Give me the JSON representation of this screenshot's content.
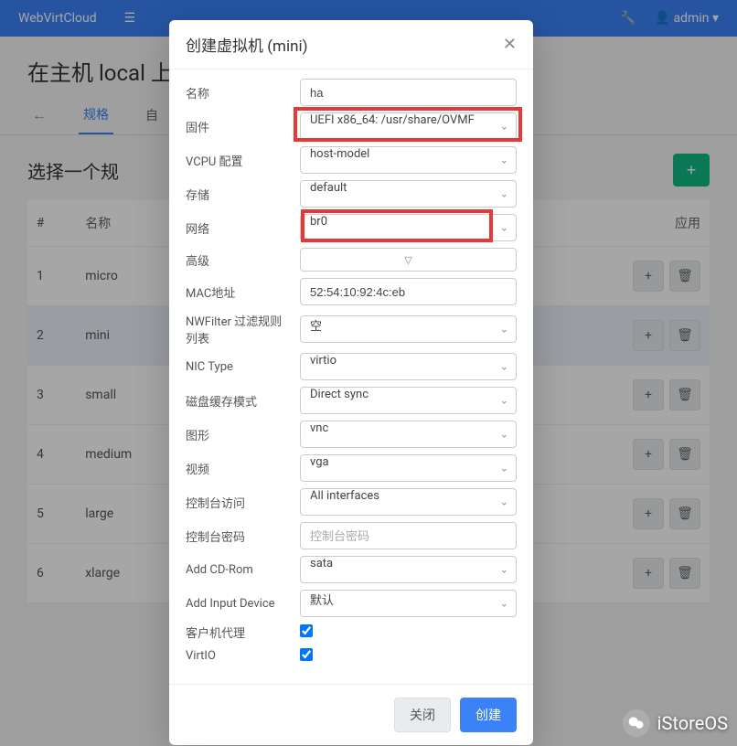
{
  "topbar": {
    "brand": "WebVirtCloud",
    "user_label": "admin",
    "caret": "▾"
  },
  "page": {
    "title_prefix": "在主机 local 上"
  },
  "tabs": {
    "back": "←",
    "spec": "规格",
    "custom": "自"
  },
  "section": {
    "title": "选择一个规",
    "add": "+"
  },
  "table": {
    "headers": {
      "idx": "#",
      "name": "名称",
      "apply": "应用"
    },
    "rows": [
      {
        "idx": "1",
        "name": "micro"
      },
      {
        "idx": "2",
        "name": "mini"
      },
      {
        "idx": "3",
        "name": "small"
      },
      {
        "idx": "4",
        "name": "medium"
      },
      {
        "idx": "5",
        "name": "large"
      },
      {
        "idx": "6",
        "name": "xlarge"
      }
    ],
    "add_icon": "+",
    "trash_icon": "🗑"
  },
  "modal": {
    "title": "创建虚拟机 (mini)",
    "labels": {
      "name": "名称",
      "firmware": "固件",
      "vcpu": "VCPU 配置",
      "storage": "存储",
      "network": "网络",
      "advanced": "高级",
      "mac": "MAC地址",
      "nwfilter": "NWFilter 过滤规则列表",
      "nic_type": "NIC Type",
      "disk_cache": "磁盘缓存模式",
      "graphics": "图形",
      "video": "视频",
      "console_access": "控制台访问",
      "console_pw": "控制台密码",
      "add_cdrom": "Add CD-Rom",
      "add_input": "Add Input Device",
      "guest_agent": "客户机代理",
      "virtio": "VirtIO"
    },
    "values": {
      "name": "ha",
      "firmware": "UEFI x86_64: /usr/share/OVMF",
      "vcpu": "host-model",
      "storage": "default",
      "network": "br0",
      "mac": "52:54:10:92:4c:eb",
      "nwfilter": "空",
      "nic_type": "virtio",
      "disk_cache": "Direct sync",
      "graphics": "vnc",
      "video": "vga",
      "console_access": "All interfaces",
      "console_pw_placeholder": "控制台密码",
      "add_cdrom": "sata",
      "add_input": "默认"
    },
    "advanced_caret": "▽",
    "footer": {
      "close": "关闭",
      "create": "创建"
    }
  },
  "watermark": {
    "text": "iStoreOS"
  }
}
